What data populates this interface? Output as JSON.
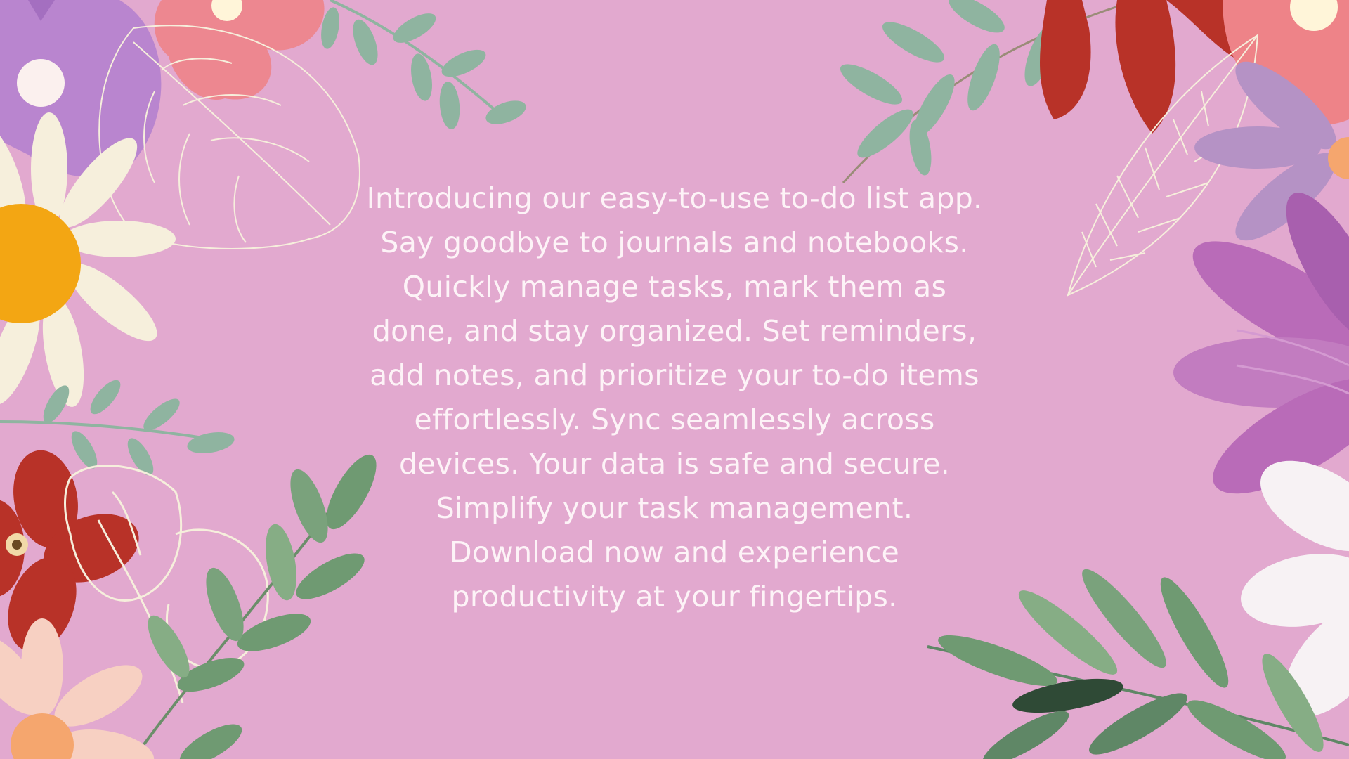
{
  "background_color": "#e2a9cf",
  "text_color": "#fdf3f7",
  "promo": {
    "text": "Introducing our easy-to-use to-do list app. Say goodbye to journals and notebooks. Quickly manage tasks, mark them as done, and stay organized. Set reminders, add notes, and prioritize your to-do items effortlessly. Sync seamlessly across devices. Your data is safe and secure. Simplify your task management. Download now and experience productivity at your fingertips."
  },
  "decor": {
    "icons": [
      "purple-flower-icon",
      "white-daisy-icon",
      "outline-leaf-icon",
      "coral-flower-icon",
      "sage-branch-icon",
      "red-flower-icon",
      "outline-flower-icon",
      "green-leaves-icon",
      "peach-daisy-icon",
      "red-lily-icon",
      "feather-leaf-icon",
      "violet-flower-icon",
      "white-petal-flower-icon"
    ],
    "colors": {
      "sage": "#8fb4a0",
      "leaf_dark": "#5f8766",
      "red": "#b83228",
      "coral": "#ee8388",
      "purple": "#b07ccc",
      "violet": "#b96bb8",
      "cream": "#f6efdc",
      "yellow": "#f3a613",
      "peach": "#f7d0c2"
    }
  }
}
